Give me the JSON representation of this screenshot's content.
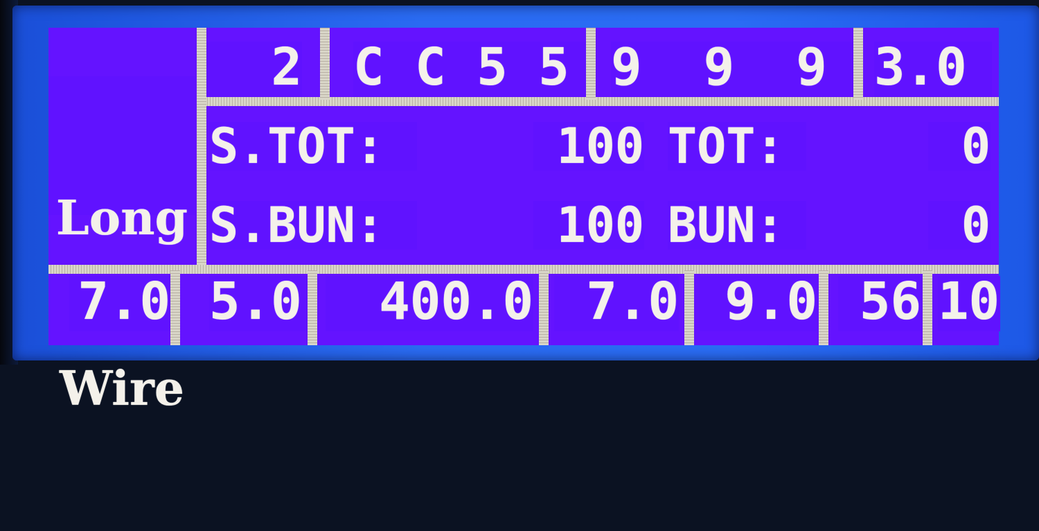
{
  "label": {
    "line1": "Long",
    "line2": "Wire"
  },
  "top_row": {
    "cell1": "2",
    "cell2": "C C 5 5",
    "cell3": "9  9  9",
    "cell4": "3.0"
  },
  "counters": {
    "s_tot_label": "S.TOT:",
    "s_tot_value": "100",
    "tot_label": "TOT:",
    "tot_value": "0",
    "s_bun_label": "S.BUN:",
    "s_bun_value": "100",
    "bun_label": "BUN:",
    "bun_value": "0"
  },
  "bottom_row": {
    "v1": "7.0",
    "v2": "5.0",
    "v3": "400.0",
    "v4": "7.0",
    "v5": "9.0",
    "v6": "56",
    "v7": "10"
  },
  "colors": {
    "screen": "#6413ff",
    "text": "#f4f1ea",
    "bezel": "#2a6bf2"
  }
}
